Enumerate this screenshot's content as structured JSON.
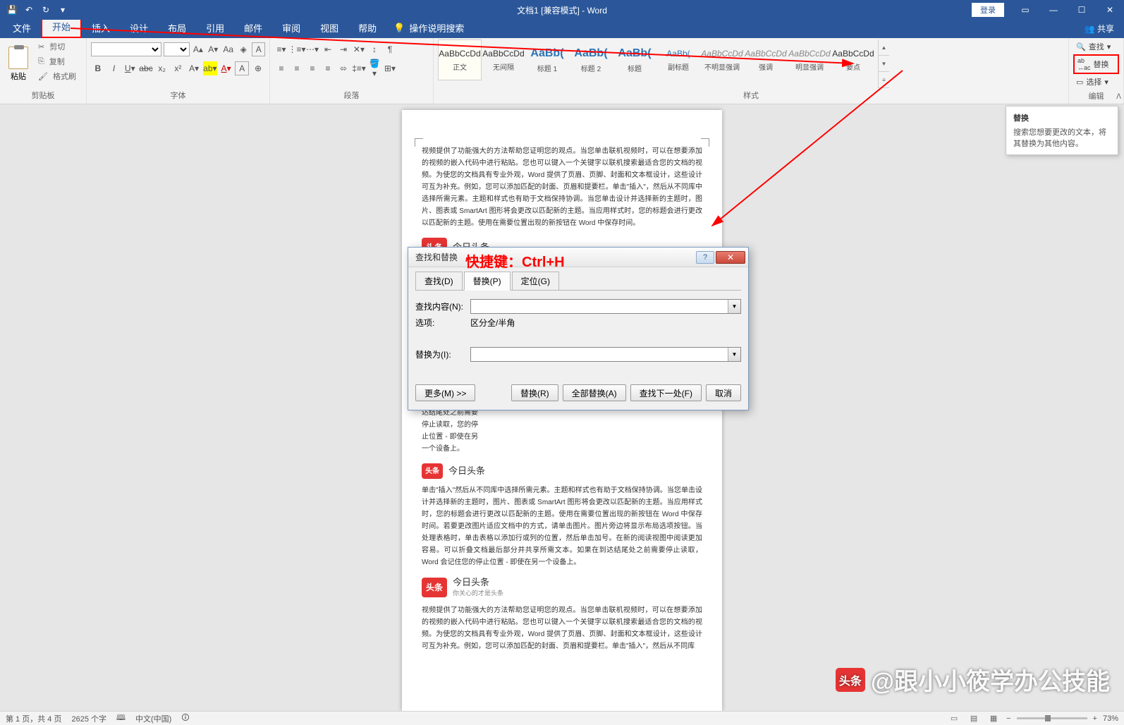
{
  "titlebar": {
    "title": "文档1 [兼容模式] - Word",
    "login": "登录"
  },
  "tabs": {
    "file": "文件",
    "home": "开始",
    "insert": "插入",
    "design": "设计",
    "layout": "布局",
    "references": "引用",
    "mailings": "邮件",
    "review": "审阅",
    "view": "视图",
    "help": "帮助",
    "search": "操作说明搜索",
    "share": "共享"
  },
  "ribbon": {
    "clipboard": {
      "paste": "粘贴",
      "cut": "剪切",
      "copy": "复制",
      "format_painter": "格式刷",
      "label": "剪贴板"
    },
    "font": {
      "label": "字体"
    },
    "paragraph": {
      "label": "段落"
    },
    "styles": {
      "label": "样式",
      "items": [
        {
          "preview": "AaBbCcDd",
          "name": "正文",
          "cls": ""
        },
        {
          "preview": "AaBbCcDd",
          "name": "无间隔",
          "cls": ""
        },
        {
          "preview": "AaBb(",
          "name": "标题 1",
          "cls": "big"
        },
        {
          "preview": "AaBb(",
          "name": "标题 2",
          "cls": "big"
        },
        {
          "preview": "AaBb(",
          "name": "标题",
          "cls": "big"
        },
        {
          "preview": "AaBb(",
          "name": "副标题",
          "cls": "blue"
        },
        {
          "preview": "AaBbCcDd",
          "name": "不明显强调",
          "cls": "gray"
        },
        {
          "preview": "AaBbCcDd",
          "name": "强调",
          "cls": "gray"
        },
        {
          "preview": "AaBbCcDd",
          "name": "明显强调",
          "cls": "gray"
        },
        {
          "preview": "AaBbCcDd",
          "name": "要点",
          "cls": ""
        }
      ]
    },
    "editing": {
      "label": "编辑",
      "find": "查找",
      "replace": "替换",
      "select": "选择"
    }
  },
  "tooltip": {
    "title": "替换",
    "body": "搜索您想要更改的文本，将其替换为其他内容。"
  },
  "document": {
    "para1": "视频提供了功能强大的方法帮助您证明您的观点。当您单击联机视频时，可以在想要添加的视频的嵌入代码中进行粘贴。您也可以键入一个关键字以联机搜索最适合您的文档的视频。为使您的文档具有专业外观，Word 提供了页眉、页脚、封面和文本框设计，这些设计可互为补充。例如，您可以添加匹配的封面、页眉和提要栏。单击\"插入\"，然后从不同库中选择所需元素。主题和样式也有助于文档保持协调。当您单击设计并选择新的主题时，图片、图表或 SmartArt 图形将会更改以匹配新的主题。当应用样式时，您的标题会进行更改以匹配新的主题。使用在需要位置出现的新按钮在 Word 中保存时间。",
    "logo": {
      "badge": "头条",
      "name": "今日头条",
      "sub": "你关心的才是头条"
    },
    "para2_left": "若要更改图片适应文档中的方式，请单击图片。图片旁边将显示布局选项按钮。当处理表格时，单击表格以添加行或列。在表格中的任何位置单击，然后单击加号。可以折叠文档最后部分并共享所需文本。如果在到达结尾处之前需要停止读取，您的停止位置 - 即使在另一个设备上。",
    "para3": "单击\"插入\"然后从不同库中选择所需元素。主题和样式也有助于文档保持协调。当您单击设计并选择新的主题时，图片、图表或 SmartArt 图形将会更改以匹配新的主题。当应用样式时，您的标题会进行更改以匹配新的主题。使用在需要位置出现的新按钮在 Word 中保存时间。若要更改图片适应文档中的方式，请单击图片。图片旁边将显示布局选项按钮。当处理表格时，单击表格以添加行或列的位置，然后单击加号。在新的阅读视图中阅读更加容易。可以折叠文档最后部分并共享所需文本。如果在到达结尾处之前需要停止读取，Word 会记住您的停止位置 - 即使在另一个设备上。",
    "para4": "视频提供了功能强大的方法帮助您证明您的观点。当您单击联机视频时，可以在想要添加的视频的嵌入代码中进行粘贴。您也可以键入一个关键字以联机搜索最适合您的文档的视频。为使您的文档具有专业外观，Word 提供了页眉、页脚、封面和文本框设计，这些设计可互为补充。例如，您可以添加匹配的封面、页眉和提要栏。单击\"插入\"，然后从不同库"
  },
  "shortcut": "快捷键：Ctrl+H",
  "dialog": {
    "title": "查找和替换",
    "tabs": {
      "find": "查找(D)",
      "replace": "替换(P)",
      "goto": "定位(G)"
    },
    "find_label": "查找内容(N):",
    "options_label": "选项:",
    "options_value": "区分全/半角",
    "replace_label": "替换为(I):",
    "buttons": {
      "more": "更多(M) >>",
      "replace": "替换(R)",
      "replace_all": "全部替换(A)",
      "find_next": "查找下一处(F)",
      "cancel": "取消"
    }
  },
  "statusbar": {
    "page": "第 1 页，共 4 页",
    "words": "2625 个字",
    "lang": "中文(中国)",
    "zoom": "73%"
  },
  "watermark": "@跟小小筱学办公技能"
}
